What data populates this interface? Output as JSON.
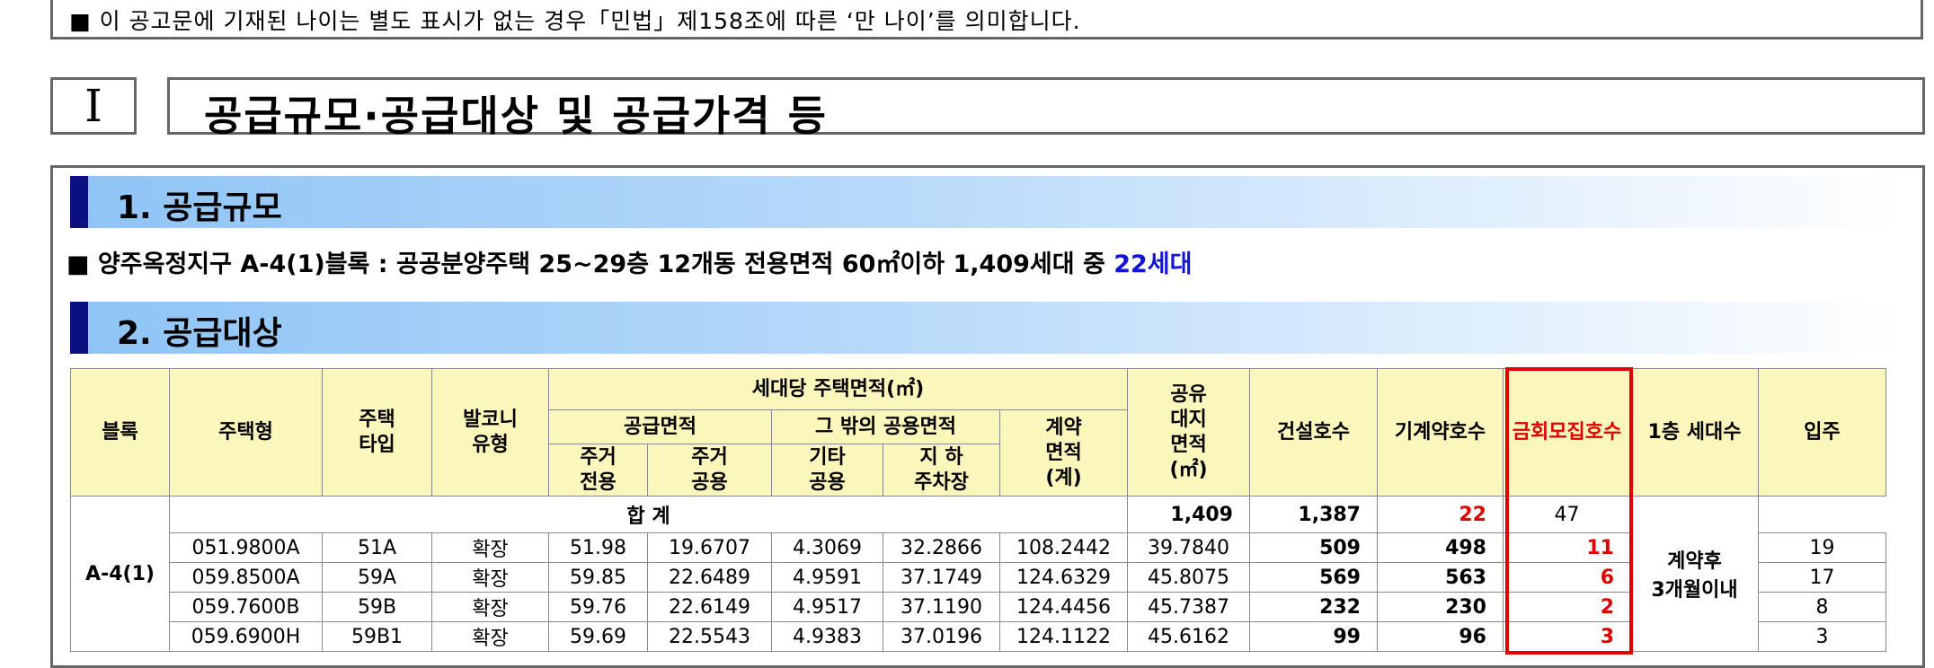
{
  "notice": {
    "bullet": "■",
    "text": "이 공고문에 기재된 나이는 별도 표시가 없는 경우「민법」제158조에 따른 ‘만 나이’를 의미합니다."
  },
  "section": {
    "numeral": "Ⅰ",
    "title": "공급규모·공급대상 및 공급가격 등"
  },
  "supply_scale": {
    "heading": "1. 공급규모",
    "bullet": "■",
    "text": "양주옥정지구 A-4(1)블록 : 공공분양주택 25~29층 12개동 전용면적 60㎡이하 1,409세대 중 ",
    "highlight": "22세대"
  },
  "supply_target": {
    "heading": "2. 공급대상",
    "table": {
      "headers": {
        "block": "블록",
        "house_type": "주택형",
        "type_line1": "주택",
        "type_line2": "타입",
        "balcony_line1": "발코니",
        "balcony_line2": "유형",
        "area_group": "세대당 주택면적(㎡)",
        "supply_area": "공급면적",
        "other_common": "그 밖의 공용면적",
        "contract_line1": "계약",
        "contract_line2": "면적",
        "contract_line3": "(계)",
        "res_private_1": "주거",
        "res_private_2": "전용",
        "res_common_1": "주거",
        "res_common_2": "공용",
        "etc_common_1": "기타",
        "etc_common_2": "공용",
        "parking_1": "지  하",
        "parking_2": "주차장",
        "land_1": "공유",
        "land_2": "대지",
        "land_3": "면적",
        "land_4": "(㎡)",
        "built": "건설호수",
        "contracted": "기계약호수",
        "recruit": "금회모집호수",
        "first_floor": "1층 세대수",
        "move_in": "입주"
      },
      "total_label": "합 계",
      "totals": {
        "built": "1,409",
        "contracted": "1,387",
        "recruit": "22",
        "first_floor": "47"
      },
      "block": "A-4(1)",
      "move_in_1": "계약후",
      "move_in_2": "3개월이내",
      "rows": [
        {
          "house_type": "051.9800A",
          "type": "51A",
          "balcony": "확장",
          "private": "51.98",
          "common": "19.6707",
          "etc": "4.3069",
          "parking": "32.2866",
          "contract": "108.2442",
          "land": "39.7840",
          "built": "509",
          "contracted": "498",
          "recruit": "11",
          "first_floor": "19"
        },
        {
          "house_type": "059.8500A",
          "type": "59A",
          "balcony": "확장",
          "private": "59.85",
          "common": "22.6489",
          "etc": "4.9591",
          "parking": "37.1749",
          "contract": "124.6329",
          "land": "45.8075",
          "built": "569",
          "contracted": "563",
          "recruit": "6",
          "first_floor": "17"
        },
        {
          "house_type": "059.7600B",
          "type": "59B",
          "balcony": "확장",
          "private": "59.76",
          "common": "22.6149",
          "etc": "4.9517",
          "parking": "37.1190",
          "contract": "124.4456",
          "land": "45.7387",
          "built": "232",
          "contracted": "230",
          "recruit": "2",
          "first_floor": "8"
        },
        {
          "house_type": "059.6900H",
          "type": "59B1",
          "balcony": "확장",
          "private": "59.69",
          "common": "22.5543",
          "etc": "4.9383",
          "parking": "37.0196",
          "contract": "124.1122",
          "land": "45.6162",
          "built": "99",
          "contracted": "96",
          "recruit": "3",
          "first_floor": "3"
        }
      ]
    }
  }
}
